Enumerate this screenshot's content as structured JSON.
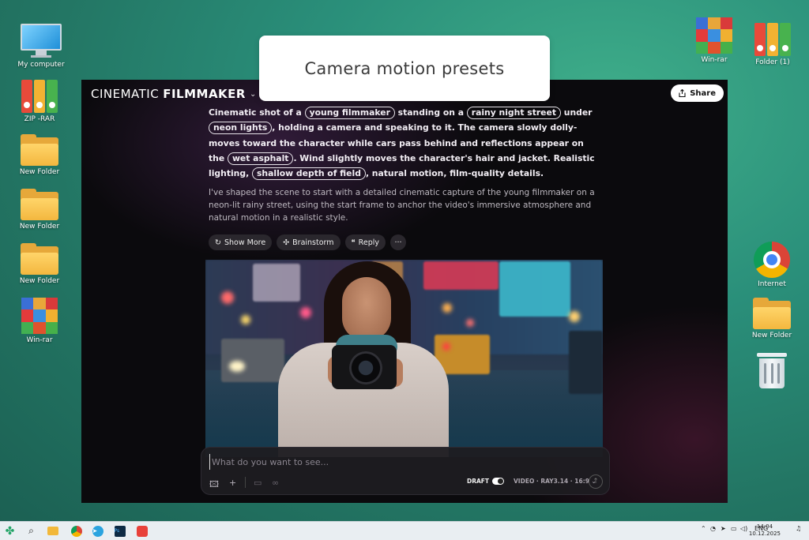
{
  "desktop_left": [
    {
      "label": "My computer"
    },
    {
      "label": "ZIP -RAR"
    },
    {
      "label": "New Folder"
    },
    {
      "label": "New Folder"
    },
    {
      "label": "New Folder"
    },
    {
      "label": "Win-rar"
    }
  ],
  "desktop_right": [
    {
      "label": "Win-rar"
    },
    {
      "label": "Folder (1)"
    },
    {
      "label": "Internet"
    },
    {
      "label": "New Folder"
    }
  ],
  "callout": {
    "text": "Camera motion presets"
  },
  "app": {
    "brand_light": "CINEMATIC",
    "brand_bold": "FILMMAKER",
    "share_label": "Share",
    "prompt": {
      "t1": "Cinematic shot of a ",
      "c1": "young filmmaker",
      "t2": " standing on a ",
      "c2": "rainy night street",
      "t3": " under ",
      "c3": "neon lights",
      "t4": ", holding a camera and speaking to it. The camera slowly dolly-moves toward the character while cars pass behind and reflections appear on the ",
      "c4": "wet asphalt",
      "t5": ". Wind slightly moves the character's hair and jacket. Realistic lighting, ",
      "c5": "shallow depth of field",
      "t6": ", natural motion, film-quality details."
    },
    "reply": "I've shaped the scene to start with a detailed cinematic capture of the young filmmaker on a neon-lit rainy street, using the start frame to anchor the video's immersive atmosphere and natural motion in a realistic style.",
    "actions": {
      "show_more": "Show More",
      "brainstorm": "Brainstorm",
      "reply": "Reply",
      "more": "···"
    },
    "composer": {
      "placeholder": "What do you want to see...",
      "draft_label": "DRAFT",
      "model_label": "VIDEO · RAY3.14 · 16:9"
    }
  },
  "taskbar": {
    "lang": "ENG",
    "time": "14:04",
    "date": "10.12.2025"
  },
  "colors": {
    "accent_chip_border": "#e8e4ea",
    "app_bg": "#0b0a0d",
    "taskbar_bg": "#e9eef2"
  }
}
